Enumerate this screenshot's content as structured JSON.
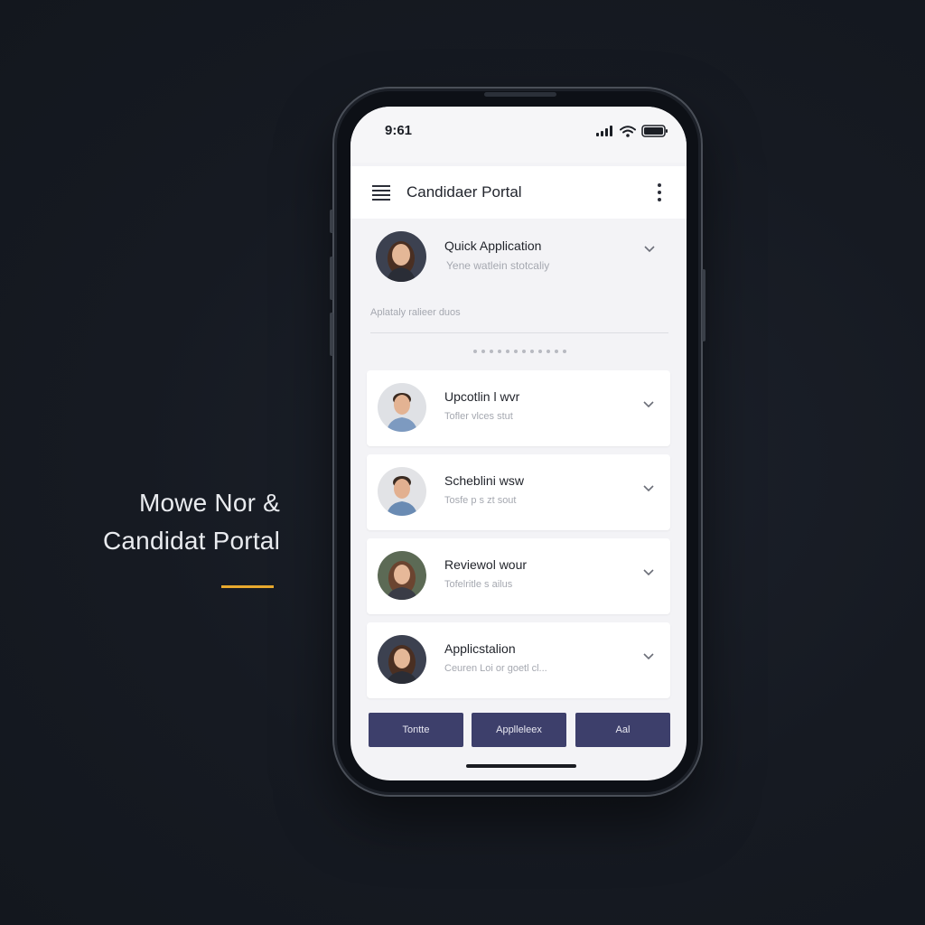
{
  "hero": {
    "line1": "Mowe Nor &",
    "line2": "Candidat Portal",
    "accent_color": "#e8a92e"
  },
  "status_bar": {
    "time": "9:61",
    "icons": [
      "signal-icon",
      "wifi-icon",
      "battery-icon"
    ]
  },
  "app_bar": {
    "title": "Candidaer Portal",
    "left_icon": "hamburger-menu-icon",
    "right_icon": "more-vertical-icon"
  },
  "quick_application": {
    "title": "Quick Application",
    "subtitle": "Yene watlein stotcaliy",
    "caption": "Aplataly ralieer duos"
  },
  "cards": [
    {
      "title": "Upcotlin l wvr",
      "subtitle": "Tofler vlces stut"
    },
    {
      "title": "Scheblini wsw",
      "subtitle": "Tosfe p s zt sout"
    },
    {
      "title": "Reviewol wour",
      "subtitle": "Tofelritle s ailus"
    },
    {
      "title": "Applicstalion",
      "subtitle": "Ceuren  Loi or goetl cl..."
    }
  ],
  "buttons": [
    {
      "label": "Tontte"
    },
    {
      "label": "Applleleex"
    },
    {
      "label": "Aal"
    }
  ],
  "colors": {
    "background": "#161a22",
    "screen": "#f3f3f6",
    "button": "#3d3f6b",
    "accent": "#e8a92e"
  }
}
